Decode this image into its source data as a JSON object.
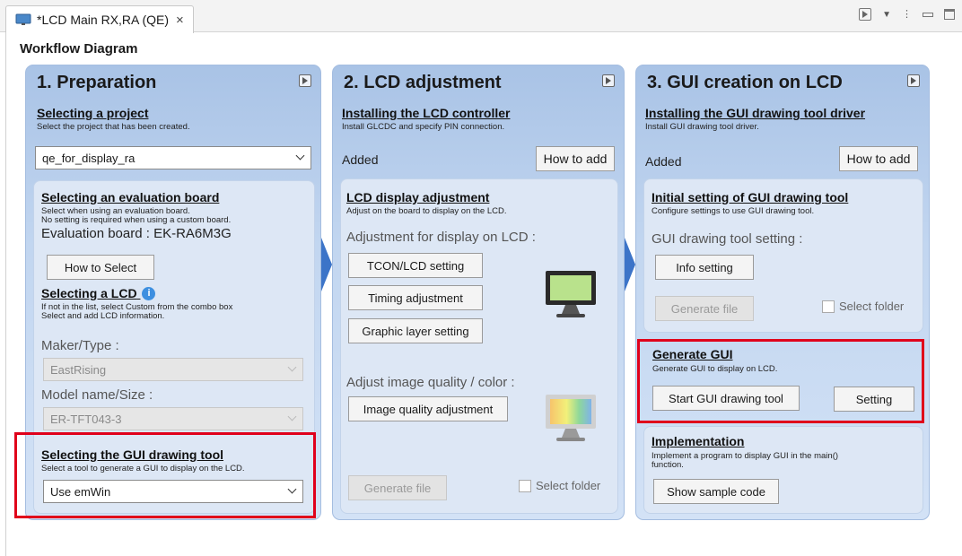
{
  "tab": {
    "title": "*LCD Main RX,RA (QE)",
    "close": "×"
  },
  "workflow": {
    "title": "Workflow Diagram"
  },
  "col1": {
    "title": "1. Preparation",
    "project": {
      "heading": "Selecting a project",
      "desc": "Select the project that has been created.",
      "value": "qe_for_display_ra"
    },
    "board": {
      "heading": "Selecting an evaluation board",
      "desc1": "Select when using an evaluation board.",
      "desc2": "No setting is required when using a custom board.",
      "label": "Evaluation board : EK-RA6M3G",
      "button": "How to Select"
    },
    "lcd": {
      "heading": "Selecting a LCD",
      "info": "i",
      "desc1": "If not in the list, select Custom from the combo box",
      "desc2": "Select and add LCD information.",
      "maker_label": "Maker/Type :",
      "maker_value": "EastRising",
      "model_label": "Model name/Size :",
      "model_value": "ER-TFT043-3"
    },
    "gui_tool": {
      "heading": "Selecting the GUI drawing tool",
      "desc": "Select a tool to generate a GUI to display on the LCD.",
      "value": "Use emWin"
    }
  },
  "col2": {
    "title": "2. LCD adjustment",
    "controller": {
      "heading": "Installing the LCD controller",
      "desc": "Install GLCDC and specify PIN connection.",
      "status": "Added",
      "button": "How to add"
    },
    "display": {
      "heading": "LCD display adjustment",
      "desc": "Adjust on the board to display on the LCD.",
      "label": "Adjustment for display on LCD :",
      "btn_tcon": "TCON/LCD setting",
      "btn_timing": "Timing adjustment",
      "btn_layer": "Graphic layer setting",
      "quality_label": "Adjust image quality / color :",
      "btn_quality": "Image quality adjustment",
      "btn_generate": "Generate file",
      "select_folder": "Select folder"
    }
  },
  "col3": {
    "title": "3. GUI creation on LCD",
    "driver": {
      "heading": "Installing the GUI drawing tool driver",
      "desc": "Install GUI drawing tool driver.",
      "status": "Added",
      "button": "How to add"
    },
    "initial": {
      "heading": "Initial setting of GUI drawing tool",
      "desc": "Configure settings to use GUI drawing tool.",
      "label": "GUI drawing tool setting :",
      "btn_info": "Info setting",
      "btn_generate": "Generate file",
      "select_folder": "Select folder"
    },
    "generate": {
      "heading": "Generate GUI",
      "desc": "Generate GUI to display on LCD.",
      "btn_start": "Start GUI drawing tool",
      "btn_setting": "Setting"
    },
    "implementation": {
      "heading": "Implementation",
      "desc1": "Implement a program to display GUI in the main()",
      "desc2": "function.",
      "btn_sample": "Show sample code"
    }
  },
  "colors": {
    "highlight": "#e0001b",
    "arrow": "#3c74c8",
    "column_bg": "#c2d6f0"
  }
}
